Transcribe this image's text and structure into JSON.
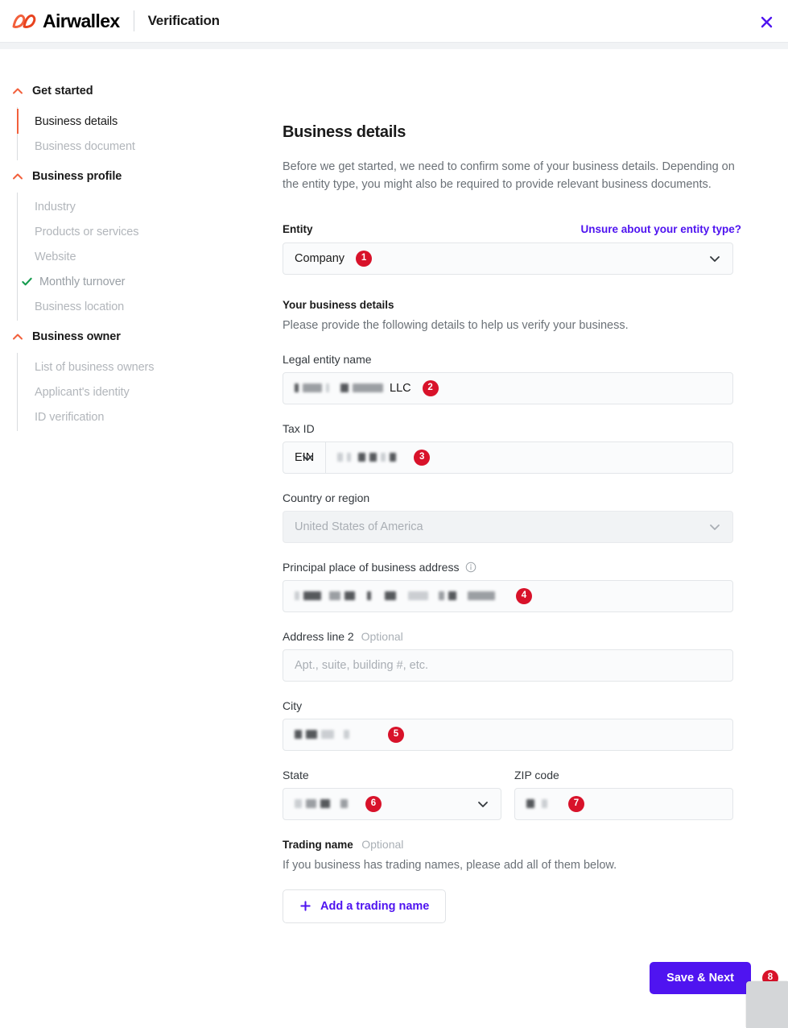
{
  "header": {
    "brand": "Airwallex",
    "title": "Verification",
    "logo_icon": "airwallex-logo-icon",
    "close_icon": "close-icon",
    "accent_color": "#f2603c",
    "link_color": "#4f14f0"
  },
  "sidebar": {
    "groups": [
      {
        "label": "Get started",
        "expanded": true,
        "items": [
          {
            "label": "Business details",
            "state": "active"
          },
          {
            "label": "Business document",
            "state": "pending"
          }
        ]
      },
      {
        "label": "Business profile",
        "expanded": true,
        "items": [
          {
            "label": "Industry",
            "state": "pending"
          },
          {
            "label": "Products or services",
            "state": "pending"
          },
          {
            "label": "Website",
            "state": "pending"
          },
          {
            "label": "Monthly turnover",
            "state": "done"
          },
          {
            "label": "Business location",
            "state": "pending"
          }
        ]
      },
      {
        "label": "Business owner",
        "expanded": true,
        "items": [
          {
            "label": "List of business owners",
            "state": "pending"
          },
          {
            "label": "Applicant's identity",
            "state": "pending"
          },
          {
            "label": "ID verification",
            "state": "pending"
          }
        ]
      }
    ]
  },
  "main": {
    "title": "Business details",
    "intro": "Before we get started, we need to confirm some of your business details. Depending on the entity type, you might also be required to provide relevant business documents.",
    "entity": {
      "label": "Entity",
      "help_link": "Unsure about your entity type?",
      "value": "Company",
      "badge": "1"
    },
    "section": {
      "title": "Your business details",
      "subtitle": "Please provide the following details to help us verify your business."
    },
    "legal_entity_name": {
      "label": "Legal entity name",
      "value_suffix": "LLC",
      "redacted": true,
      "badge": "2"
    },
    "tax_id": {
      "label": "Tax ID",
      "type_value": "EIN",
      "value_redacted": true,
      "badge": "3"
    },
    "country": {
      "label": "Country or region",
      "value": "United States of America",
      "disabled": true
    },
    "address": {
      "label": "Principal place of business address",
      "info_icon": "info-icon",
      "value_redacted": true,
      "badge": "4"
    },
    "address_line2": {
      "label": "Address line 2",
      "optional": "Optional",
      "placeholder": "Apt., suite, building #, etc."
    },
    "city": {
      "label": "City",
      "value_redacted": true,
      "badge": "5"
    },
    "state": {
      "label": "State",
      "value_redacted": true,
      "badge": "6"
    },
    "zip": {
      "label": "ZIP code",
      "value_redacted": true,
      "badge": "7"
    },
    "trading_name": {
      "label": "Trading name",
      "optional": "Optional",
      "description": "If you business has trading names, please add all of them below.",
      "add_button": "Add a trading name"
    },
    "save_button": {
      "label": "Save & Next",
      "badge": "8"
    }
  }
}
